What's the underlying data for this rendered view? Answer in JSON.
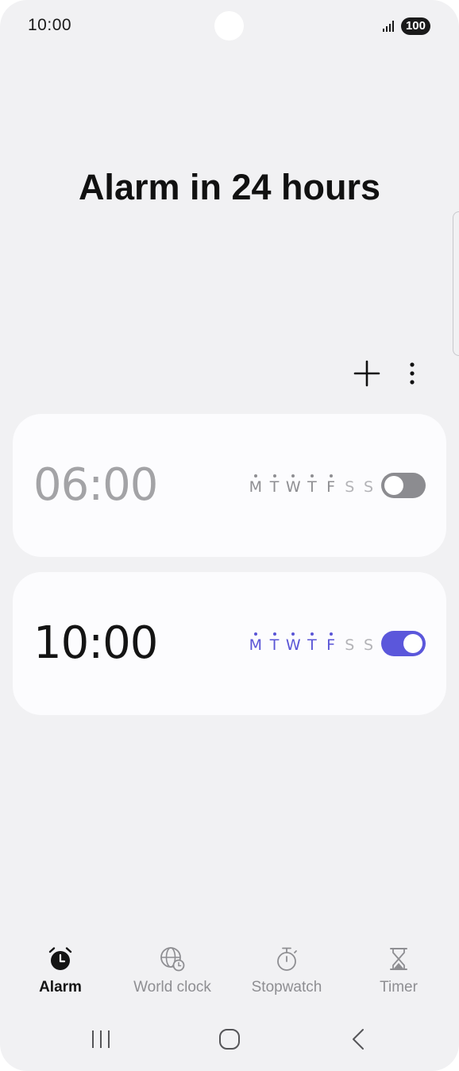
{
  "status_bar": {
    "time": "10:00",
    "battery": "100"
  },
  "header": {
    "title": "Alarm in 24 hours"
  },
  "toolbar": {
    "add_icon": "plus-icon",
    "more_icon": "more-vertical-icon"
  },
  "alarms": [
    {
      "time": "06:00",
      "enabled": false,
      "days": [
        {
          "letter": "M",
          "selected": true
        },
        {
          "letter": "T",
          "selected": true
        },
        {
          "letter": "W",
          "selected": true
        },
        {
          "letter": "T",
          "selected": true
        },
        {
          "letter": "F",
          "selected": true
        },
        {
          "letter": "S",
          "selected": false
        },
        {
          "letter": "S",
          "selected": false
        }
      ]
    },
    {
      "time": "10:00",
      "enabled": true,
      "days": [
        {
          "letter": "M",
          "selected": true
        },
        {
          "letter": "T",
          "selected": true
        },
        {
          "letter": "W",
          "selected": true
        },
        {
          "letter": "T",
          "selected": true
        },
        {
          "letter": "F",
          "selected": true
        },
        {
          "letter": "S",
          "selected": false
        },
        {
          "letter": "S",
          "selected": false
        }
      ]
    }
  ],
  "bottom_nav": [
    {
      "label": "Alarm",
      "icon": "alarm-clock-icon",
      "active": true
    },
    {
      "label": "World clock",
      "icon": "globe-clock-icon",
      "active": false
    },
    {
      "label": "Stopwatch",
      "icon": "stopwatch-icon",
      "active": false
    },
    {
      "label": "Timer",
      "icon": "hourglass-icon",
      "active": false
    }
  ],
  "system_nav": {
    "recents_icon": "recents-icon",
    "home_icon": "home-icon",
    "back_icon": "back-icon"
  },
  "colors": {
    "background": "#f1f1f3",
    "card": "#fcfcfe",
    "accent": "#5b57db",
    "toggle_off": "#8c8c90",
    "disabled_text": "#a3a3a6"
  }
}
